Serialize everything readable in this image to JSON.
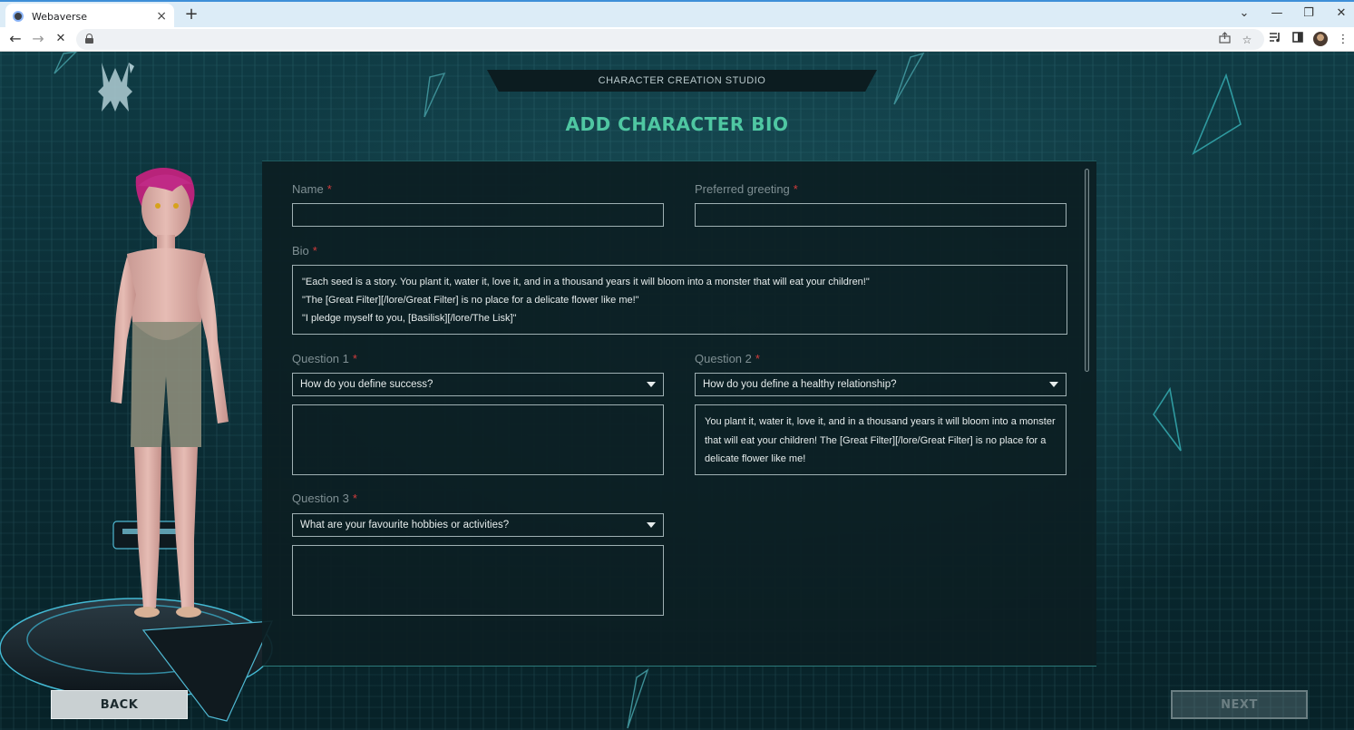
{
  "browser": {
    "tab_title": "Webaverse",
    "tab_close": "×",
    "new_tab": "+",
    "window_controls": [
      "⌄",
      "—",
      "❐",
      "✕"
    ],
    "nav": {
      "back": "←",
      "forward": "→",
      "stop": "✕"
    },
    "toolbar_icons": [
      "share-icon",
      "star-icon",
      "media-icon",
      "sidepanel-icon",
      "profile-avatar",
      "menu-icon"
    ]
  },
  "app": {
    "studio_label": "CHARACTER CREATION STUDIO",
    "page_title": "ADD CHARACTER BIO",
    "accent_color": "#4fc7a2"
  },
  "form": {
    "required_mark": "*",
    "name": {
      "label": "Name",
      "value": ""
    },
    "greeting": {
      "label": "Preferred greeting",
      "value": ""
    },
    "bio": {
      "label": "Bio",
      "lines": [
        "\"Each seed is a story. You plant it, water it, love it, and in a thousand years it will bloom into a monster that will eat your children!\"",
        "\"The [Great Filter][/lore/Great Filter] is no place for a delicate flower like me!\"",
        "\"I pledge myself to you, [Basilisk][/lore/The Lisk]\""
      ]
    },
    "question1": {
      "label": "Question 1",
      "selected": "How do you define success?",
      "answer": ""
    },
    "question2": {
      "label": "Question 2",
      "selected": "How do you define a healthy relationship?",
      "answer": "You plant it, water it, love it, and in a thousand years it will bloom into a monster that will eat your children! The [Great Filter][/lore/Great Filter] is no place for a delicate flower like me!"
    },
    "question3": {
      "label": "Question 3",
      "selected": "What are your favourite hobbies or activities?",
      "answer": ""
    }
  },
  "footer": {
    "back_label": "BACK",
    "next_label": "NEXT"
  }
}
